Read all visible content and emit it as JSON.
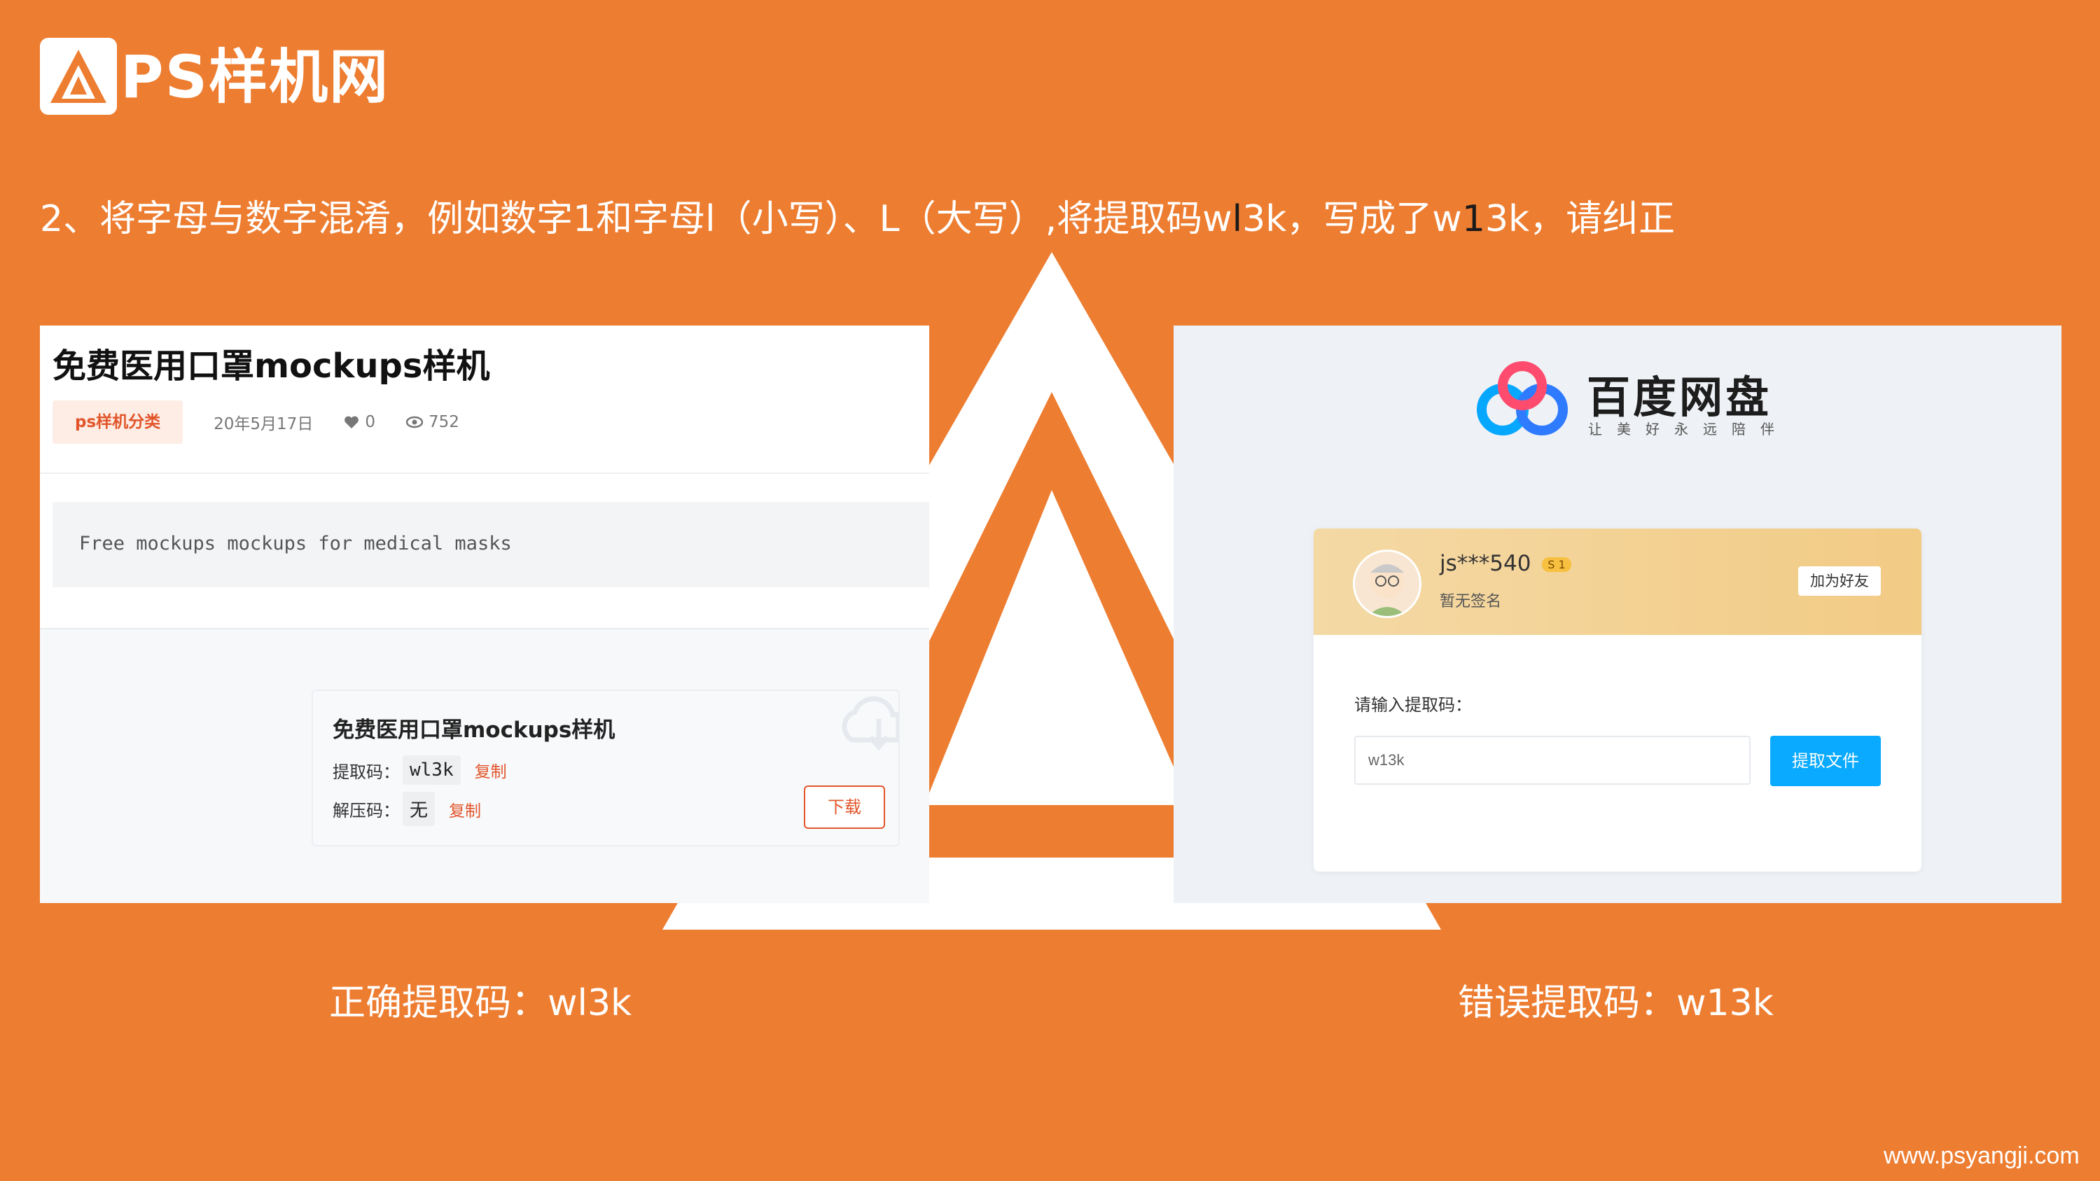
{
  "brand": {
    "logo_text": "PS样机网",
    "site_url": "www.psyangji.com"
  },
  "headline": {
    "prefix": "2、将字母与数字混淆，例如数字1和字母l（小写）、L（大写）,将提取码w",
    "hl1": "l",
    "mid": "3k，写成了w",
    "hl2": "1",
    "suffix": "3k，请纠正"
  },
  "left_panel": {
    "title": "免费医用口罩mockups样机",
    "category_tag": "ps样机分类",
    "date": "20年5月17日",
    "likes": "0",
    "views": "752",
    "description": "Free mockups mockups for medical masks",
    "download_card": {
      "title": "免费医用口罩mockups样机",
      "extract_label": "提取码：",
      "extract_code": "wl3k",
      "unzip_label": "解压码：",
      "unzip_code": "无",
      "copy_label": "复制",
      "download_label": "下载"
    }
  },
  "right_panel": {
    "app_name": "百度网盘",
    "slogan": "让美好永远陪伴",
    "user": {
      "name": "js***540",
      "signature": "暂无签名",
      "badge": "S 1"
    },
    "add_friend_label": "加为好友",
    "prompt_label": "请输入提取码：",
    "input_value": "w13k",
    "submit_label": "提取文件"
  },
  "captions": {
    "correct": "正确提取码：wl3k",
    "wrong": "错误提取码：w13k"
  },
  "colors": {
    "background": "#ED7D31",
    "baidu_blue": "#09AAFF",
    "accent_red": "#E2552B"
  }
}
